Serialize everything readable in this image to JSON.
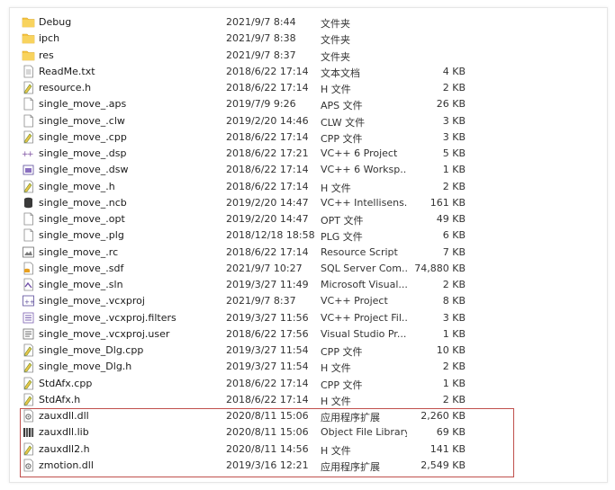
{
  "files": [
    {
      "name": "Debug",
      "date": "2021/9/7 8:44",
      "type": "文件夹",
      "size": "",
      "icon": "folder-icon"
    },
    {
      "name": "ipch",
      "date": "2021/9/7 8:38",
      "type": "文件夹",
      "size": "",
      "icon": "folder-icon"
    },
    {
      "name": "res",
      "date": "2021/9/7 8:37",
      "type": "文件夹",
      "size": "",
      "icon": "folder-icon"
    },
    {
      "name": "ReadMe.txt",
      "date": "2018/6/22 17:14",
      "type": "文本文档",
      "size": "4 KB",
      "icon": "text-file-icon"
    },
    {
      "name": "resource.h",
      "date": "2018/6/22 17:14",
      "type": "H 文件",
      "size": "2 KB",
      "icon": "code-file-icon"
    },
    {
      "name": "single_move_.aps",
      "date": "2019/7/9 9:26",
      "type": "APS 文件",
      "size": "26 KB",
      "icon": "generic-file-icon"
    },
    {
      "name": "single_move_.clw",
      "date": "2019/2/20 14:46",
      "type": "CLW 文件",
      "size": "3 KB",
      "icon": "generic-file-icon"
    },
    {
      "name": "single_move_.cpp",
      "date": "2018/6/22 17:14",
      "type": "CPP 文件",
      "size": "3 KB",
      "icon": "code-file-icon"
    },
    {
      "name": "single_move_.dsp",
      "date": "2018/6/22 17:21",
      "type": "VC++ 6 Project",
      "size": "5 KB",
      "icon": "vc-project-icon"
    },
    {
      "name": "single_move_.dsw",
      "date": "2018/6/22 17:14",
      "type": "VC++ 6 Worksp...",
      "size": "1 KB",
      "icon": "vc-workspace-icon"
    },
    {
      "name": "single_move_.h",
      "date": "2018/6/22 17:14",
      "type": "H 文件",
      "size": "2 KB",
      "icon": "code-file-icon"
    },
    {
      "name": "single_move_.ncb",
      "date": "2019/2/20 14:47",
      "type": "VC++ Intellisens...",
      "size": "161 KB",
      "icon": "database-icon"
    },
    {
      "name": "single_move_.opt",
      "date": "2019/2/20 14:47",
      "type": "OPT 文件",
      "size": "49 KB",
      "icon": "generic-file-icon"
    },
    {
      "name": "single_move_.plg",
      "date": "2018/12/18 18:58",
      "type": "PLG 文件",
      "size": "6 KB",
      "icon": "generic-file-icon"
    },
    {
      "name": "single_move_.rc",
      "date": "2018/6/22 17:14",
      "type": "Resource Script",
      "size": "7 KB",
      "icon": "resource-script-icon"
    },
    {
      "name": "single_move_.sdf",
      "date": "2021/9/7 10:27",
      "type": "SQL Server Com...",
      "size": "74,880 KB",
      "icon": "sql-file-icon"
    },
    {
      "name": "single_move_.sln",
      "date": "2019/3/27 11:49",
      "type": "Microsoft Visual...",
      "size": "2 KB",
      "icon": "solution-file-icon"
    },
    {
      "name": "single_move_.vcxproj",
      "date": "2021/9/7 8:37",
      "type": "VC++ Project",
      "size": "8 KB",
      "icon": "vcxproj-icon"
    },
    {
      "name": "single_move_.vcxproj.filters",
      "date": "2019/3/27 11:56",
      "type": "VC++ Project Fil...",
      "size": "3 KB",
      "icon": "filters-file-icon"
    },
    {
      "name": "single_move_.vcxproj.user",
      "date": "2018/6/22 17:56",
      "type": "Visual Studio Pr...",
      "size": "1 KB",
      "icon": "user-file-icon"
    },
    {
      "name": "single_move_Dlg.cpp",
      "date": "2019/3/27 11:54",
      "type": "CPP 文件",
      "size": "10 KB",
      "icon": "code-file-icon"
    },
    {
      "name": "single_move_Dlg.h",
      "date": "2019/3/27 11:54",
      "type": "H 文件",
      "size": "2 KB",
      "icon": "code-file-icon"
    },
    {
      "name": "StdAfx.cpp",
      "date": "2018/6/22 17:14",
      "type": "CPP 文件",
      "size": "1 KB",
      "icon": "code-file-icon"
    },
    {
      "name": "StdAfx.h",
      "date": "2018/6/22 17:14",
      "type": "H 文件",
      "size": "2 KB",
      "icon": "code-file-icon"
    },
    {
      "name": "zauxdll.dll",
      "date": "2020/8/11 15:06",
      "type": "应用程序扩展",
      "size": "2,260 KB",
      "icon": "dll-file-icon"
    },
    {
      "name": "zauxdll.lib",
      "date": "2020/8/11 15:06",
      "type": "Object File Library",
      "size": "69 KB",
      "icon": "lib-file-icon"
    },
    {
      "name": "zauxdll2.h",
      "date": "2020/8/11 14:56",
      "type": "H 文件",
      "size": "141 KB",
      "icon": "code-file-icon"
    },
    {
      "name": "zmotion.dll",
      "date": "2019/3/16 12:21",
      "type": "应用程序扩展",
      "size": "2,549 KB",
      "icon": "dll-file-icon"
    }
  ],
  "colors": {
    "folder": "#f5c443",
    "highlight_border": "#c0504d",
    "text": "#1a1a1a",
    "type_text": "#333333"
  }
}
